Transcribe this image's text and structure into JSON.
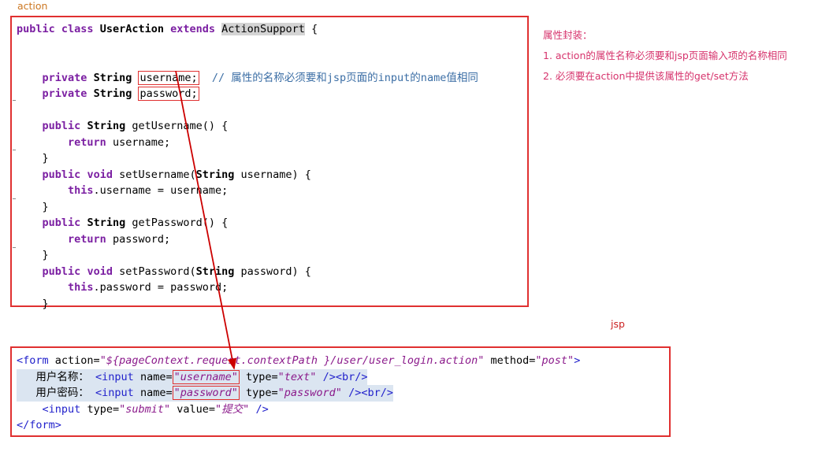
{
  "labels": {
    "action": "action",
    "jsp": "jsp"
  },
  "action_code": {
    "lines": [
      "public class UserAction extends ActionSupport {",
      "",
      "    private String username;  // 属性的名称必须要和jsp页面的input的name值相同",
      "    private String password;",
      "",
      "    public String getUsername() {",
      "        return username;",
      "    }",
      "    public void setUsername(String username) {",
      "        this.username = username;",
      "    }",
      "    public String getPassword() {",
      "        return password;",
      "    }",
      "    public void setPassword(String password) {",
      "        this.password = password;",
      "    }"
    ],
    "tokens": {
      "public": "public",
      "class": "class",
      "extends": "extends",
      "class_name": "UserAction",
      "super_class": "ActionSupport",
      "brace_open": "{",
      "brace_close": "}",
      "private": "private",
      "string_type": "String",
      "void_type": "void",
      "this": "this",
      "return": "return",
      "field_username": "username;",
      "field_password": "password;",
      "comment": "// 属性的名称必须要和jsp页面的input的name值相同",
      "get_username": "    public String getUsername() {",
      "return_username": "        return username;",
      "set_username_sig": "    public void setUsername(String username) {",
      "set_username_body": "        this.username = username;",
      "get_password": "    public String getPassword() {",
      "return_password": "        return password;",
      "set_password_sig": "    public void setPassword(String password) {",
      "set_password_body": "        this.password = password;"
    }
  },
  "annotation": {
    "title": "属性封装：",
    "items": [
      "1. action的属性名称必须要和jsp页面输入项的名称相同",
      "2. 必须要在action中提供该属性的get/set方法"
    ]
  },
  "jsp_code": {
    "line1": {
      "open": "<form",
      "attr_action": "action=",
      "val_action": "\"${pageContext.request.contextPath }/user/user_login.action\"",
      "attr_method": "method=",
      "val_method": "\"post\"",
      "close": ">"
    },
    "line2": {
      "label": "用户名称：",
      "tag_open": "<input",
      "attr_name": "name=",
      "val_name": "\"username\"",
      "attr_type": "type=",
      "val_type": "\"text\"",
      "selfclose": "/>",
      "br": "<br/>"
    },
    "line3": {
      "label": "用户密码：",
      "tag_open": "<input",
      "attr_name": "name=",
      "val_name": "\"password\"",
      "attr_type": "type=",
      "val_type": "\"password\"",
      "selfclose": "/>",
      "br": "<br/>"
    },
    "line4": {
      "tag_open": "<input",
      "attr_type": "type=",
      "val_type": "\"submit\"",
      "attr_value": "value=",
      "val_value": "\"提交\"",
      "selfclose": "/>"
    },
    "line5": {
      "close": "</form>"
    }
  },
  "colors": {
    "box_border": "#e03030",
    "keyword": "#7b1fa2",
    "comment": "#3b6ea5",
    "annotation": "#d6336c",
    "label_action": "#cc7722",
    "label_jsp": "#cc2222",
    "tag": "#2222cc",
    "attr_value": "#8b1a8b",
    "row_highlight": "#dbe5f1",
    "token_highlight": "#d4d4d4",
    "arrow": "#cc0000"
  }
}
